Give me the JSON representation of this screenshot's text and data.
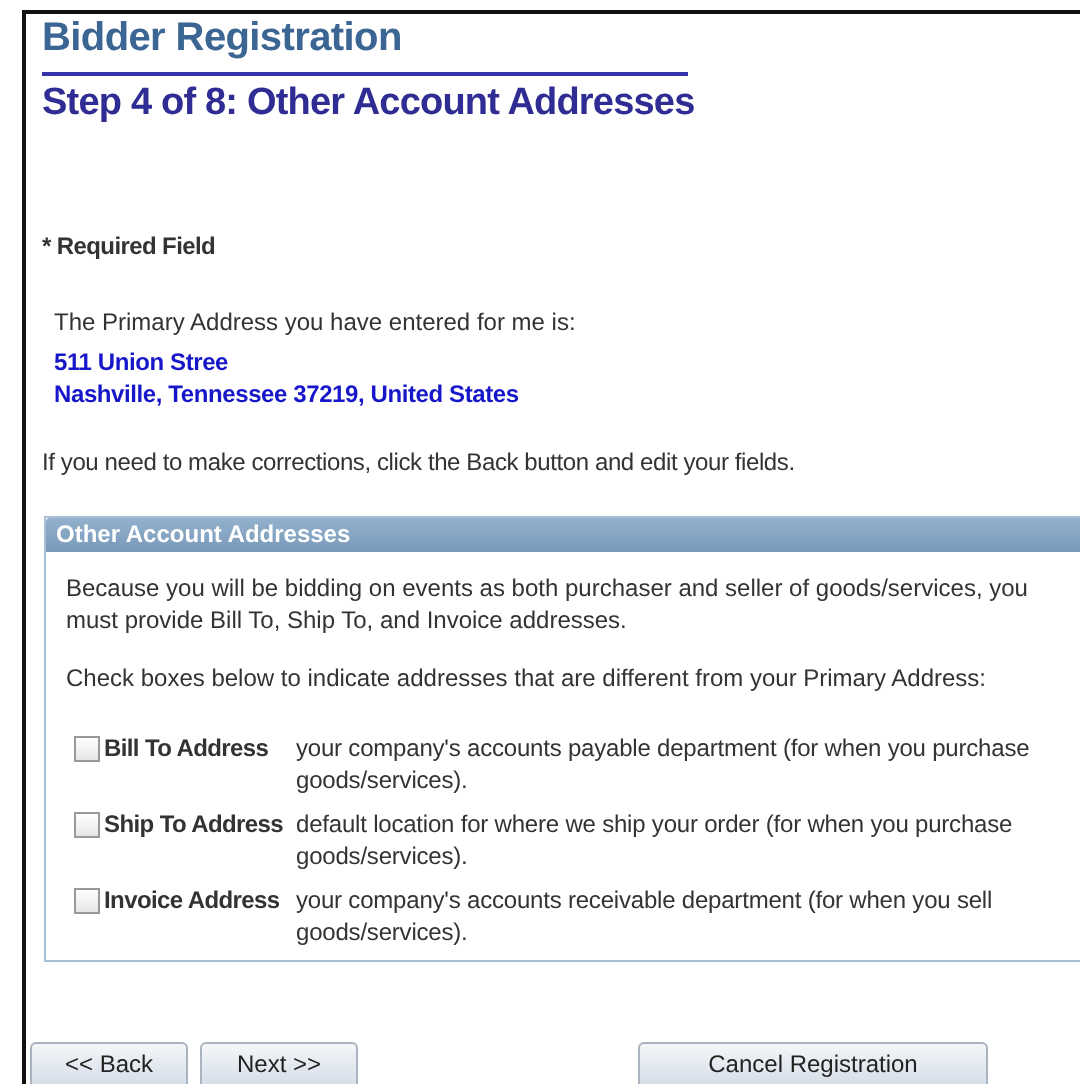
{
  "page_title": "Bidder Registration",
  "step_title": "Step 4 of 8: Other Account Addresses",
  "required_note": "* Required Field",
  "primary_intro": "The Primary Address you have entered for me is:",
  "primary_address": [
    "511 Union Stree",
    "Nashville, Tennessee 37219, United States"
  ],
  "corrections_note": "If you need to make corrections, click the Back button and edit your fields.",
  "panel": {
    "title": "Other Account Addresses",
    "intro": "Because you will be bidding on events as both purchaser and seller of goods/services, you must provide Bill To, Ship To, and Invoice addresses.",
    "instruction": "Check boxes below to indicate addresses that are different from your Primary Address:",
    "options": [
      {
        "label": "Bill To Address",
        "description": "your company's accounts payable department (for when you purchase goods/services).",
        "checked": false
      },
      {
        "label": "Ship To Address",
        "description": "default location for where we ship your order (for when you purchase goods/services).",
        "checked": false
      },
      {
        "label": "Invoice Address",
        "description": "your company's accounts receivable department (for when you sell goods/services).",
        "checked": false
      }
    ]
  },
  "buttons": {
    "back": "<< Back",
    "next": "Next >>",
    "cancel": "Cancel Registration"
  }
}
